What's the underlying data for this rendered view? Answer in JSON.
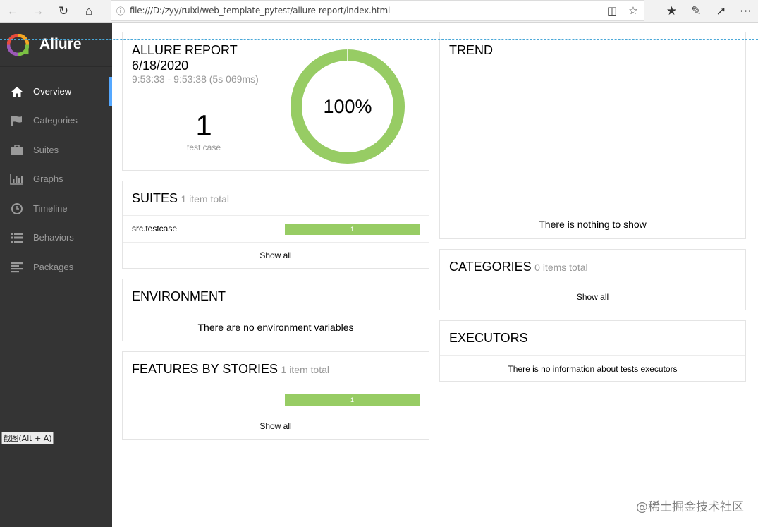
{
  "browser": {
    "url": "file:///D:/zyy/ruixi/web_template_pytest/allure-report/index.html"
  },
  "sidebar": {
    "brand": "Allure",
    "items": [
      {
        "label": "Overview",
        "icon": "home-icon",
        "active": true
      },
      {
        "label": "Categories",
        "icon": "flag-icon",
        "active": false
      },
      {
        "label": "Suites",
        "icon": "briefcase-icon",
        "active": false
      },
      {
        "label": "Graphs",
        "icon": "bar-chart-icon",
        "active": false
      },
      {
        "label": "Timeline",
        "icon": "clock-icon",
        "active": false
      },
      {
        "label": "Behaviors",
        "icon": "list-icon",
        "active": false
      },
      {
        "label": "Packages",
        "icon": "align-left-icon",
        "active": false
      }
    ],
    "tooltip": "截图(Alt + A)"
  },
  "summary": {
    "title": "ALLURE REPORT",
    "date": "6/18/2020",
    "time_range": "9:53:33 - 9:53:38 (5s 069ms)",
    "test_count": "1",
    "test_count_label": "test case",
    "success_percent_label": "100%",
    "success_fraction": 1.0
  },
  "suites": {
    "title": "SUITES",
    "subtitle": "1 item total",
    "rows": [
      {
        "name": "src.testcase",
        "count": "1"
      }
    ],
    "show_all": "Show all"
  },
  "environment": {
    "title": "ENVIRONMENT",
    "empty_message": "There are no environment variables"
  },
  "features": {
    "title": "FEATURES BY STORIES",
    "subtitle": "1 item total",
    "rows": [
      {
        "name": "",
        "count": "1"
      }
    ],
    "show_all": "Show all"
  },
  "trend": {
    "title": "TREND",
    "empty_message": "There is nothing to show"
  },
  "categories": {
    "title": "CATEGORIES",
    "subtitle": "0 items total",
    "show_all": "Show all"
  },
  "executors": {
    "title": "EXECUTORS",
    "empty_message": "There is no information about tests executors"
  },
  "watermark": "@稀土掘金技术社区",
  "colors": {
    "passed": "#97cc64",
    "sidebar_bg": "#343434",
    "active_accent": "#55a8ff"
  }
}
